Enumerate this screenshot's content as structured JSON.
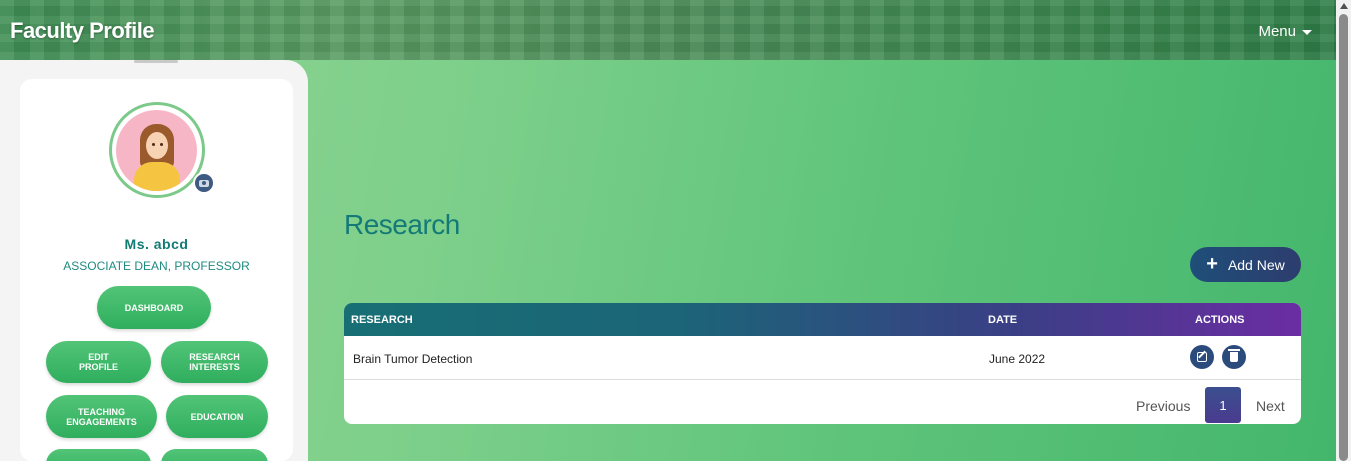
{
  "header": {
    "title": "Faculty Profile",
    "menu_label": "Menu"
  },
  "profile": {
    "name": "Ms. abcd",
    "role": "ASSOCIATE DEAN, PROFESSOR"
  },
  "sidebar": {
    "buttons": [
      {
        "label": "DASHBOARD"
      },
      {
        "label": "EDIT\nPROFILE"
      },
      {
        "label": "RESEARCH\nINTERESTS"
      },
      {
        "label": "TEACHING\nENGAGEMENTS"
      },
      {
        "label": "EDUCATION"
      }
    ]
  },
  "main": {
    "title": "Research",
    "add_label": "Add New",
    "table": {
      "headers": [
        "RESEARCH",
        "DATE",
        "ACTIONS"
      ],
      "rows": [
        {
          "research": "Brain Tumor Detection",
          "date": "June 2022"
        }
      ]
    },
    "pagination": {
      "previous": "Previous",
      "current": "1",
      "next": "Next"
    }
  },
  "icons": {
    "camera": "camera-icon",
    "edit": "edit-icon",
    "delete": "trash-icon",
    "plus": "plus-icon",
    "caret": "caret-down-icon"
  },
  "colors": {
    "primary": "#127b73",
    "accent_button": "#2c4b7d",
    "pill_green": "#3cb96a"
  }
}
